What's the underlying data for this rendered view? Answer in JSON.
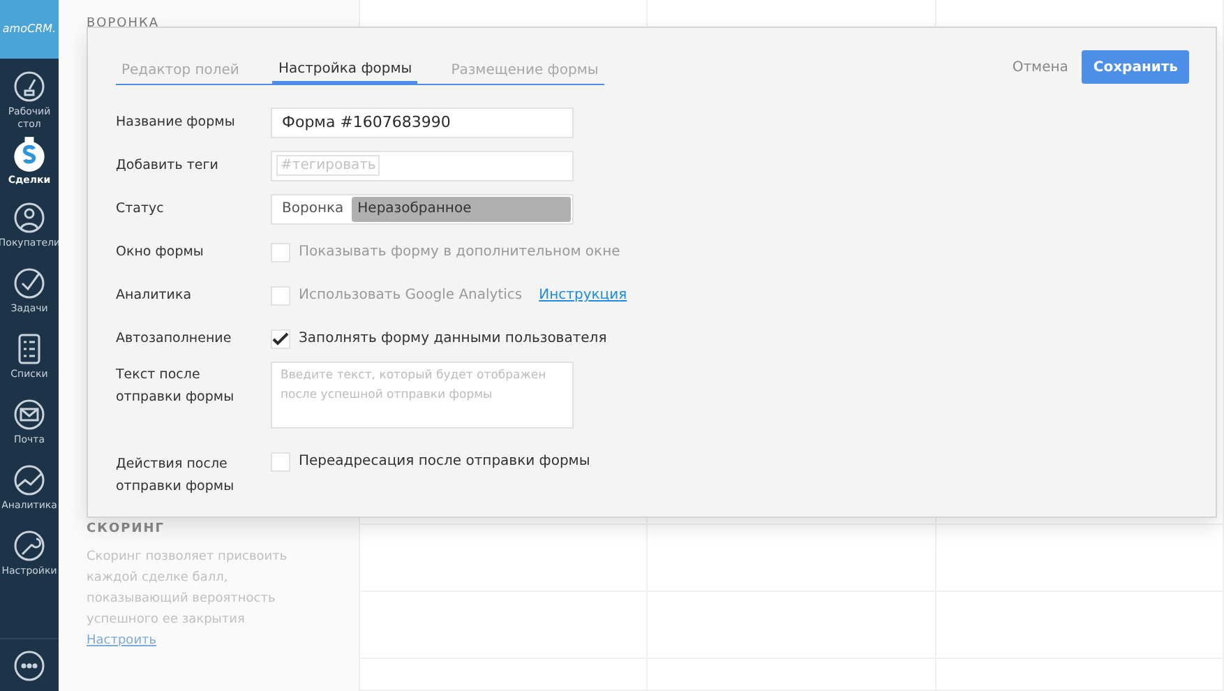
{
  "sidebar": {
    "logo": "amoCRM.",
    "items": [
      {
        "label": "Рабочий стол",
        "selected": false
      },
      {
        "label": "Сделки",
        "selected": true
      },
      {
        "label": "Покупатели",
        "selected": false
      },
      {
        "label": "Задачи",
        "selected": false
      },
      {
        "label": "Списки",
        "selected": false
      },
      {
        "label": "Почта",
        "selected": false
      },
      {
        "label": "Аналитика",
        "selected": false
      },
      {
        "label": "Настройки",
        "selected": false
      }
    ]
  },
  "background": {
    "header": "ВОРОНКА",
    "scoring": {
      "title": "СКОРИНГ",
      "text": "Скоринг позволяет присвоить каждой сделке балл, показывающий вероятность успешного ее закрытия",
      "link": "Настроить"
    }
  },
  "modal": {
    "tabs": [
      {
        "label": "Редактор полей",
        "selected": false
      },
      {
        "label": "Настройка формы",
        "selected": true
      },
      {
        "label": "Размещение формы",
        "selected": false
      }
    ],
    "cancel": "Отмена",
    "save": "Сохранить",
    "rows": [
      {
        "kind": "text",
        "label": "Название формы",
        "value": "Форма #1607683990"
      },
      {
        "kind": "tags",
        "label": "Добавить теги",
        "placeholder": "#тегировать"
      },
      {
        "kind": "status",
        "label": "Статус",
        "pipeline": "Воронка",
        "stage": "Неразобранное"
      },
      {
        "kind": "checkbox",
        "label": "Окно формы",
        "option": "Показывать форму в дополнительном окне",
        "checked": false
      },
      {
        "kind": "checkbox",
        "label": "Аналитика",
        "option": "Использовать Google Analytics",
        "checked": false,
        "link": "Инструкция"
      },
      {
        "kind": "checkbox",
        "label": "Автозаполнение",
        "option": "Заполнять форму данными пользователя",
        "checked": true
      },
      {
        "kind": "textarea",
        "label": "Текст после отправки формы",
        "placeholder": "Введите текст, который будет отображен после успешной отправки формы"
      },
      {
        "kind": "checkbox",
        "label": "Действия после отправки формы",
        "option": "Переадресация после отправки формы",
        "checked": false
      }
    ]
  }
}
